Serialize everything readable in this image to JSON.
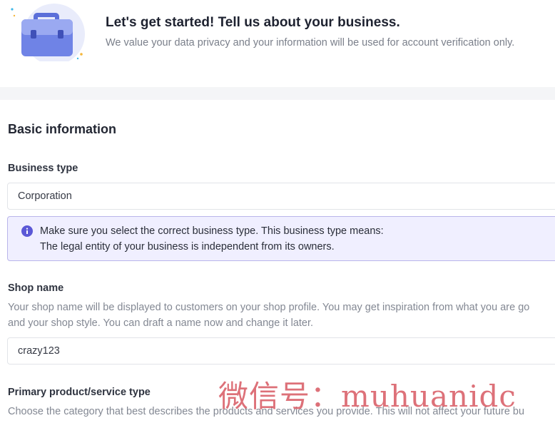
{
  "header": {
    "title": "Let's get started! Tell us about your business.",
    "subtitle": "We value your data privacy and your information will be used for account verification only.",
    "illustration_icon": "briefcase-icon"
  },
  "basic_info": {
    "section_title": "Basic information",
    "business_type": {
      "label": "Business type",
      "value": "Corporation"
    },
    "notice": {
      "icon": "info-icon",
      "line1": "Make sure you select the correct business type. This business type means:",
      "line2": "The legal entity of your business is independent from its owners."
    },
    "shop_name": {
      "label": "Shop name",
      "help_line1": "Your shop name will be displayed to customers on your shop profile. You may get inspiration from what you are go",
      "help_line2": "and your shop style. You can draft a name now and change it later.",
      "value": "crazy123"
    },
    "primary_type": {
      "label": "Primary product/service type",
      "help_line1": "Choose the category that best describes the products and services you provide. This will not affect your future bu"
    }
  },
  "watermark": "微信号：muhuanidc",
  "colors": {
    "accent": "#5b58d6",
    "notice_bg": "#f0efff",
    "notice_border": "#b9b5ea",
    "watermark": "#d6525c"
  }
}
